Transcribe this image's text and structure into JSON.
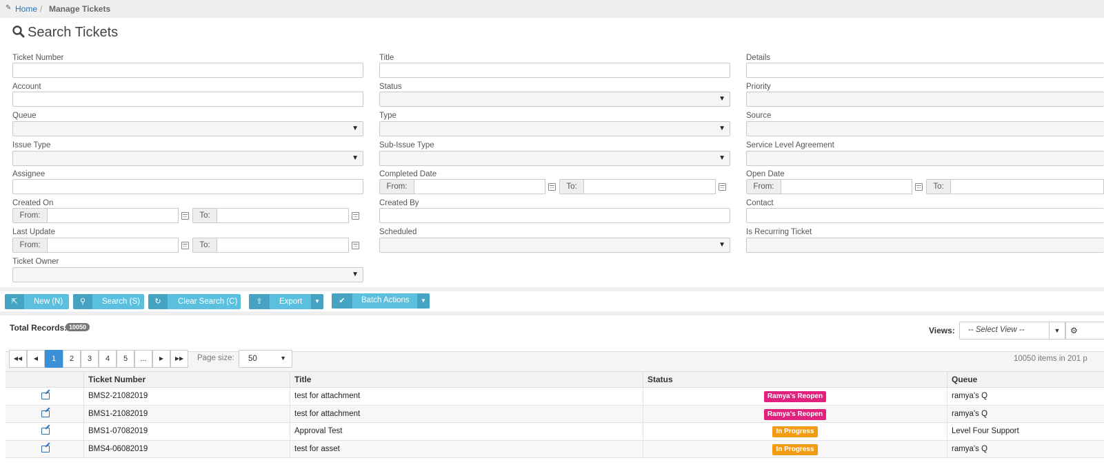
{
  "breadcrumb": {
    "home": "Home",
    "separator": "/",
    "current": "Manage Tickets"
  },
  "search": {
    "title": "Search Tickets",
    "labels": {
      "ticket_number": "Ticket Number",
      "title": "Title",
      "details": "Details",
      "account": "Account",
      "status": "Status",
      "priority": "Priority",
      "queue": "Queue",
      "type": "Type",
      "source": "Source",
      "issue_type": "Issue Type",
      "sub_issue_type": "Sub-Issue Type",
      "sla": "Service Level Agreement",
      "assignee": "Assignee",
      "completed_date": "Completed Date",
      "open_date": "Open Date",
      "created_on": "Created On",
      "created_by": "Created By",
      "contact": "Contact",
      "last_update": "Last Update",
      "scheduled": "Scheduled",
      "is_recurring": "Is Recurring Ticket",
      "ticket_owner": "Ticket Owner",
      "from": "From:",
      "to": "To:"
    }
  },
  "toolbar": {
    "new": "New (N)",
    "search": "Search (S)",
    "clear": "Clear Search (C)",
    "export": "Export",
    "batch": "Batch Actions"
  },
  "records": {
    "label": "Total Records:",
    "count": "10050"
  },
  "views": {
    "label": "Views:",
    "placeholder": "-- Select View --"
  },
  "pager": {
    "pages": [
      "1",
      "2",
      "3",
      "4",
      "5",
      "..."
    ],
    "page_size_label": "Page size:",
    "page_size": "50",
    "summary": "10050 items in 201 p"
  },
  "table": {
    "headers": [
      "Ticket Number",
      "Title",
      "Status",
      "Queue"
    ],
    "rows": [
      {
        "ticket": "BMS2-21082019",
        "title": "test for attachment",
        "status": "Ramya's Reopen",
        "status_color": "#e0217d",
        "queue": "ramya's Q"
      },
      {
        "ticket": "BMS1-21082019",
        "title": "test for attachment",
        "status": "Ramya's Reopen",
        "status_color": "#e0217d",
        "queue": "ramya's Q"
      },
      {
        "ticket": "BMS1-07082019",
        "title": "Approval Test",
        "status": "In Progress",
        "status_color": "#f39c12",
        "queue": "Level Four Support"
      },
      {
        "ticket": "BMS4-06082019",
        "title": "test for asset",
        "status": "In Progress",
        "status_color": "#f39c12",
        "queue": "ramya's Q"
      }
    ]
  },
  "colors": {
    "button": "#5bc0de",
    "button_dark": "#46a4c2",
    "active_page": "#3b8fd6",
    "link": "#2a6fb6"
  }
}
